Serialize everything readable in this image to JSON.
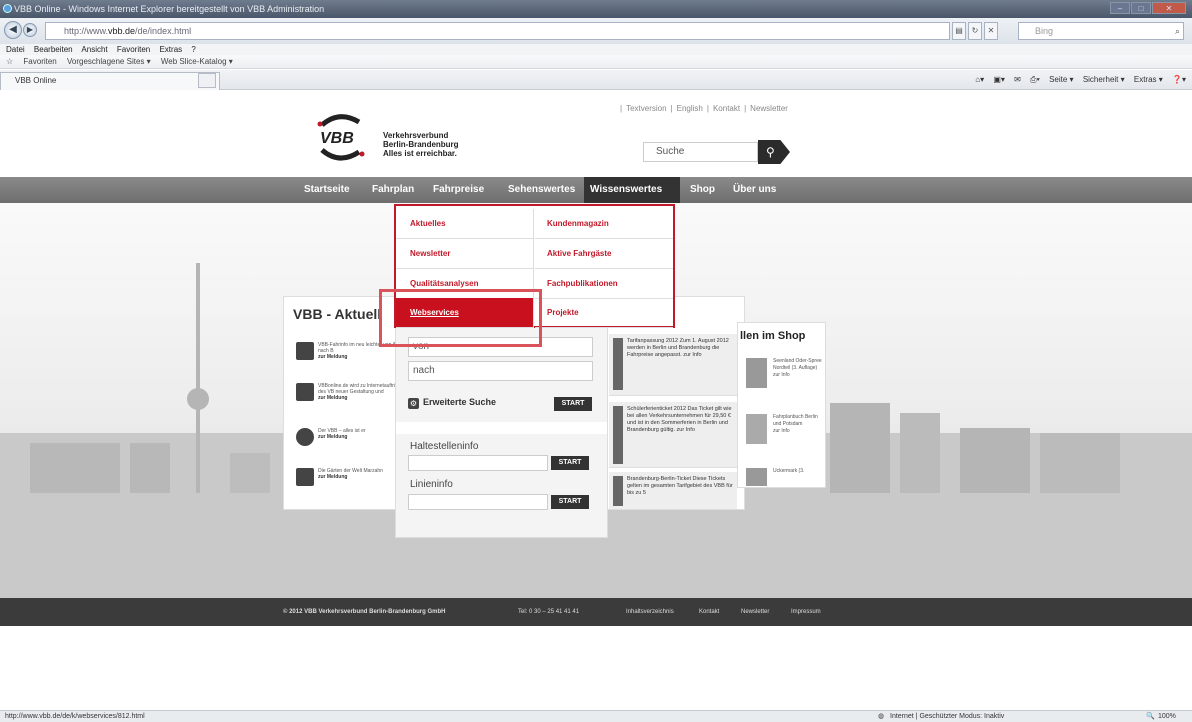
{
  "window": {
    "title": "VBB Online - Windows Internet Explorer bereitgestellt von VBB Administration"
  },
  "address": {
    "url_prefix": "http://www.",
    "url_host": "vbb.de",
    "url_path": "/de/index.html",
    "search_placeholder": "Bing"
  },
  "menubar": [
    "Datei",
    "Bearbeiten",
    "Ansicht",
    "Favoriten",
    "Extras",
    "?"
  ],
  "favorites": {
    "label": "Favoriten",
    "items": [
      "Vorgeschlagene Sites ▾",
      "Web Slice-Katalog ▾"
    ]
  },
  "tab": {
    "label": "VBB Online"
  },
  "commandbar": [
    "Seite ▾",
    "Sicherheit ▾",
    "Extras ▾"
  ],
  "site": {
    "logo_text": "VBB",
    "brand_lines": [
      "Verkehrsverbund",
      "Berlin-Brandenburg",
      "Alles ist erreichbar."
    ],
    "top_links": [
      "Textversion",
      "English",
      "Kontakt",
      "Newsletter"
    ],
    "search_placeholder": "Suche",
    "nav": [
      "Startseite",
      "Fahrplan",
      "Fahrpreise",
      "Sehenswertes",
      "Wissenswertes",
      "Shop",
      "Über uns"
    ]
  },
  "dropdown": {
    "left": [
      "Aktuelles",
      "Newsletter",
      "Qualitätsanalysen",
      "Webservices"
    ],
    "right": [
      "Kundenmagazin",
      "Aktive Fahrgäste",
      "Fachpublikationen",
      "Projekte"
    ]
  },
  "aktuell": {
    "title": "VBB - Aktuell",
    "news": [
      {
        "text": "VBB-Fahrinfo im neu leichter von A nach B",
        "link": "zur Meldung"
      },
      {
        "text": "VBBonline.de wird zu Internetauftritt des VB neuer Gestaltung und",
        "link": "zur Meldung"
      },
      {
        "text": "Der VBB – alles ist er",
        "link": "zur Meldung"
      },
      {
        "text": "Die Gärten der Welt Marzahn",
        "link": "zur Meldung"
      }
    ]
  },
  "fahrplan": {
    "from": "von",
    "to": "nach",
    "extended": "Erweiterte Suche",
    "start": "START",
    "halt_label": "Haltestelleninfo",
    "linie_label": "Linieninfo"
  },
  "tarif": [
    {
      "text": "Tarifanpassung 2012 Zum 1. August 2012 werden in Berlin und Brandenburg die Fahrpreise angepasst.",
      "link": "zur Info"
    },
    {
      "text": "Schülerferienticket 2012 Das Ticket gilt wie bei allen Verkehrsunternehmen für 29,50 € und ist in den Sommerferien in Berlin und Brandenburg gültig.",
      "link": "zur Info"
    },
    {
      "text": "Brandenburg-Berlin-Ticket Diese Tickets gelten im gesamten Tarifgebiet des VBB für bis zu 5",
      "link": ""
    }
  ],
  "shop": {
    "title": "llen im Shop",
    "items": [
      {
        "text": "Seenland Oder-Spree Nordteil (3. Auflage)",
        "link": "zur Info"
      },
      {
        "text": "Fahrplanbuch Berlin und Potsdam",
        "link": "zur Info"
      },
      {
        "text": "Uckermark (3.",
        "link": ""
      }
    ]
  },
  "footer": {
    "copyright": "© 2012 VBB Verkehrsverbund Berlin-Brandenburg GmbH",
    "tel": "Tel: 0 30 – 25 41 41 41",
    "links": [
      "Inhaltsverzeichnis",
      "Kontakt",
      "Newsletter",
      "Impressum"
    ]
  },
  "status": {
    "url": "http://www.vbb.de/de/k/webservices/812.html",
    "zone": "Internet | Geschützter Modus: Inaktiv",
    "zoom": "100%"
  }
}
